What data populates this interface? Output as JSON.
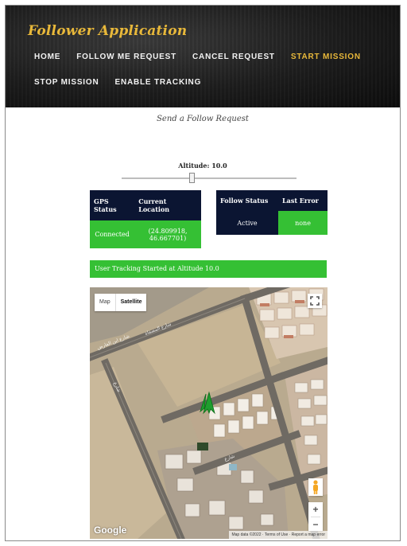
{
  "app": {
    "title": "Follower Application"
  },
  "nav": {
    "items": [
      {
        "label": "HOME"
      },
      {
        "label": "FOLLOW ME REQUEST"
      },
      {
        "label": "CANCEL REQUEST"
      },
      {
        "label": "START MISSION"
      },
      {
        "label": "STOP MISSION"
      },
      {
        "label": "ENABLE TRACKING"
      }
    ],
    "active": "START MISSION"
  },
  "page": {
    "subtitle": "Send a Follow Request",
    "altitude_label": "Altitude: 10.0",
    "altitude_slider_fraction": 0.4
  },
  "gps_table": {
    "headers": [
      "GPS Status",
      "Current Location"
    ],
    "status": "Connected",
    "location": "(24.809918, 46.667701)"
  },
  "follow_table": {
    "headers": [
      "Follow Status",
      "Last Error"
    ],
    "status": "Active",
    "error": "none"
  },
  "banner": {
    "text": "User Tracking Started at Altitude 10.0"
  },
  "map": {
    "type_options": [
      "Map",
      "Satellite"
    ],
    "selected_type": "Satellite",
    "logo": "Google",
    "zoom_in": "+",
    "zoom_out": "−",
    "attribution": "Map data ©2022 · Terms of Use · Report a map error"
  },
  "colors": {
    "accent": "#e8b83a",
    "status_green": "#35c034",
    "table_dark": "#0b1532"
  }
}
